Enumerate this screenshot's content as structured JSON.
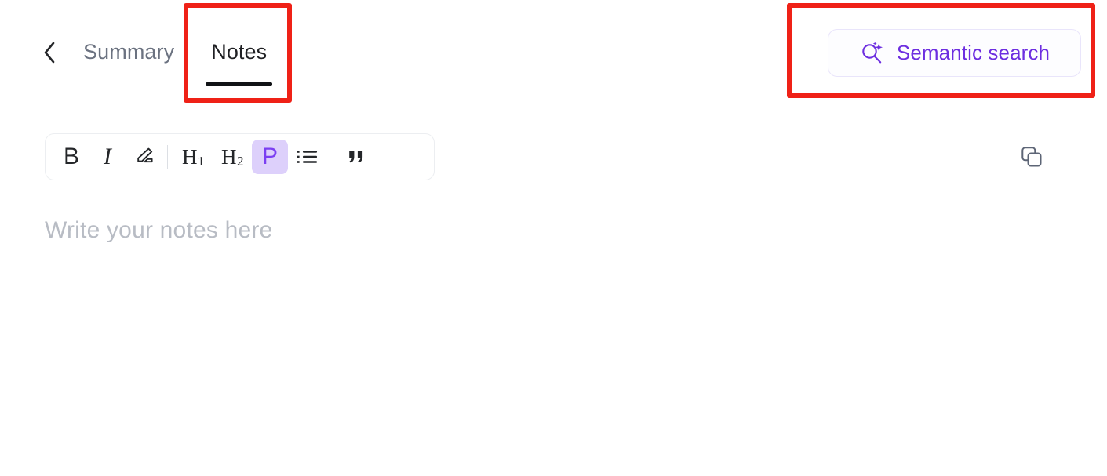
{
  "header": {
    "back_icon": "chevron-left-icon",
    "tabs": [
      {
        "label": "Summary",
        "active": false
      },
      {
        "label": "Notes",
        "active": true
      }
    ],
    "semantic_search": {
      "label": "Semantic search",
      "icon": "magnifier-sparkle-icon",
      "text_color": "#6d2ee0",
      "border_color": "#e9e5fb"
    }
  },
  "annotations": [
    {
      "name": "notes-tab-highlight",
      "color": "#ef2117"
    },
    {
      "name": "semantic-search-highlight",
      "color": "#ef2117"
    }
  ],
  "toolbar": {
    "items": [
      {
        "id": "bold",
        "glyph": "B",
        "icon": "bold-icon",
        "active": false
      },
      {
        "id": "italic",
        "glyph": "I",
        "icon": "italic-icon",
        "active": false
      },
      {
        "id": "highlight",
        "glyph": "",
        "icon": "highlighter-pen-icon",
        "active": false
      },
      {
        "id": "heading1",
        "glyph": "H",
        "sub": "1",
        "icon": "heading-1-icon",
        "active": false
      },
      {
        "id": "heading2",
        "glyph": "H",
        "sub": "2",
        "icon": "heading-2-icon",
        "active": false
      },
      {
        "id": "paragraph",
        "glyph": "P",
        "icon": "paragraph-icon",
        "active": true
      },
      {
        "id": "bullet-list",
        "glyph": "",
        "icon": "bullet-list-icon",
        "active": false
      },
      {
        "id": "blockquote",
        "glyph": "\"",
        "icon": "blockquote-icon",
        "active": false
      }
    ],
    "active_color": "#ddd0fb",
    "active_text_color": "#7b3ff2",
    "copy_icon": "copy-icon"
  },
  "editor": {
    "placeholder": "Write your notes here",
    "value": ""
  }
}
